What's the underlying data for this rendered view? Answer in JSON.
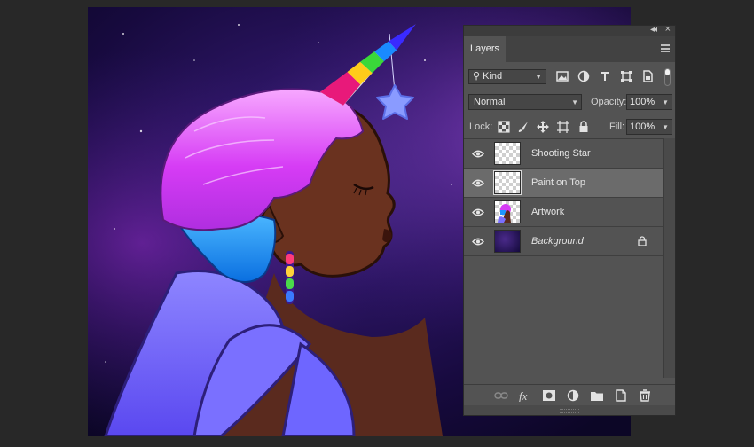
{
  "panel": {
    "tab_label": "Layers",
    "kind_filter": "Kind",
    "blend_mode": "Normal",
    "opacity_label": "Opacity:",
    "opacity_value": "100%",
    "lock_label": "Lock:",
    "fill_label": "Fill:",
    "fill_value": "100%",
    "filter_icons": [
      "image-filter-icon",
      "adjustment-filter-icon",
      "type-filter-icon",
      "shape-filter-icon",
      "smart-object-filter-icon"
    ],
    "lock_icons": [
      "lock-transparent-pixels-icon",
      "lock-image-pixels-icon",
      "lock-position-icon",
      "lock-artboard-icon",
      "lock-all-icon"
    ],
    "bottom_icons": [
      "link-layers-icon",
      "fx-icon",
      "add-mask-icon",
      "adjustment-layer-icon",
      "new-group-icon",
      "new-layer-icon",
      "delete-layer-icon"
    ]
  },
  "layers": [
    {
      "name": "Shooting Star",
      "selected": false,
      "italic": false,
      "locked": false
    },
    {
      "name": "Paint on Top",
      "selected": true,
      "italic": false,
      "locked": false
    },
    {
      "name": "Artwork",
      "selected": false,
      "italic": false,
      "locked": false
    },
    {
      "name": "Background",
      "selected": false,
      "italic": true,
      "locked": true
    }
  ],
  "colors": {
    "app_background": "#282828",
    "panel_background": "#535353",
    "selected_row": "#6b6b6b",
    "canvas_space": "#140a3c",
    "hair_pink": "#e04bff",
    "hair_blue": "#1e96ff",
    "star": "#8a9bff"
  }
}
